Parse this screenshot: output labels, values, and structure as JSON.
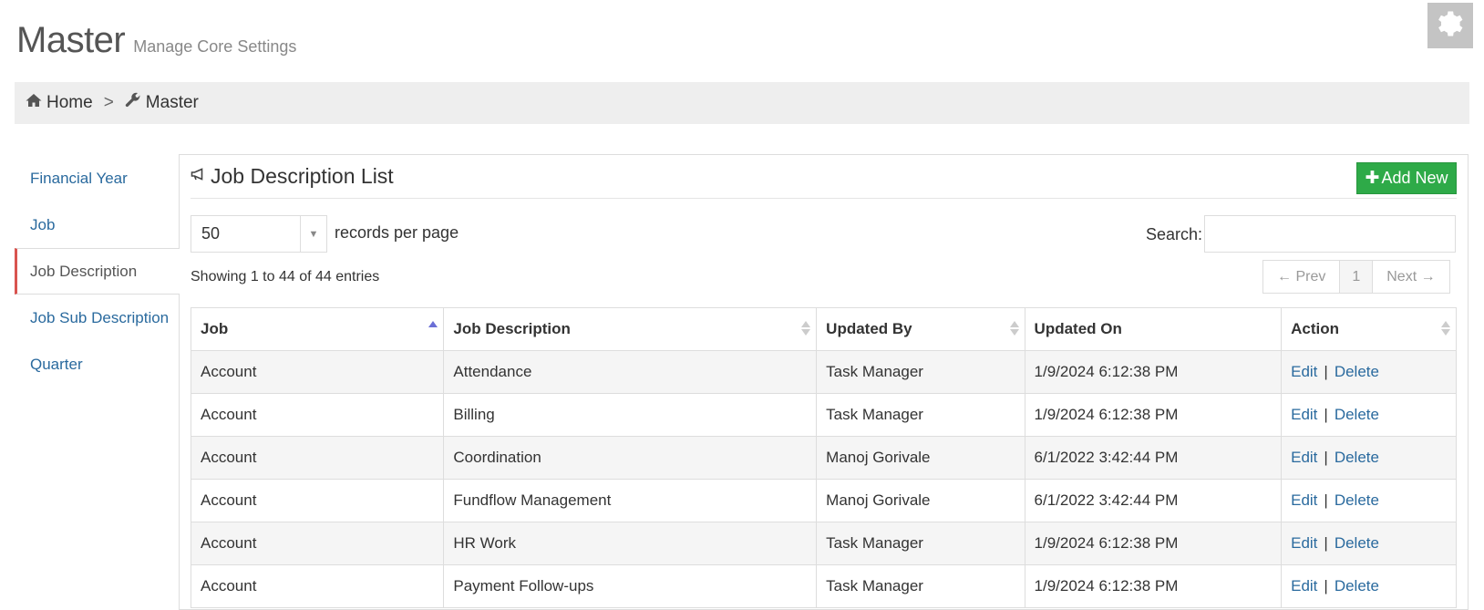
{
  "header": {
    "title": "Master",
    "subtitle": "Manage Core Settings"
  },
  "breadcrumb": {
    "home": "Home",
    "separator": ">",
    "current": "Master"
  },
  "sidebar": {
    "items": [
      {
        "label": "Financial Year"
      },
      {
        "label": "Job"
      },
      {
        "label": "Job Description",
        "active": true
      },
      {
        "label": "Job Sub Description"
      },
      {
        "label": "Quarter"
      }
    ]
  },
  "panel": {
    "title": "Job Description List",
    "add_label": "Add New",
    "add_color": "#2eaa48"
  },
  "controls": {
    "page_length": "50",
    "page_length_label": "records per page",
    "search_label": "Search:",
    "search_value": "",
    "info": "Showing 1 to 44 of 44 entries"
  },
  "pagination": {
    "prev": "← Prev",
    "page": "1",
    "next": "Next →"
  },
  "table": {
    "columns": [
      "Job",
      "Job Description",
      "Updated By",
      "Updated On",
      "Action"
    ],
    "sorted_column": "Job",
    "rows": [
      {
        "job": "Account",
        "description": "Attendance",
        "updated_by": "Task Manager",
        "updated_on": "1/9/2024 6:12:38 PM",
        "edit": "Edit",
        "sep": "|",
        "delete": "Delete"
      },
      {
        "job": "Account",
        "description": "Billing",
        "updated_by": "Task Manager",
        "updated_on": "1/9/2024 6:12:38 PM",
        "edit": "Edit",
        "sep": "|",
        "delete": "Delete"
      },
      {
        "job": "Account",
        "description": "Coordination",
        "updated_by": "Manoj Gorivale",
        "updated_on": "6/1/2022 3:42:44 PM",
        "edit": "Edit",
        "sep": "|",
        "delete": "Delete"
      },
      {
        "job": "Account",
        "description": "Fundflow Management",
        "updated_by": "Manoj Gorivale",
        "updated_on": "6/1/2022 3:42:44 PM",
        "edit": "Edit",
        "sep": "|",
        "delete": "Delete"
      },
      {
        "job": "Account",
        "description": "HR Work",
        "updated_by": "Task Manager",
        "updated_on": "1/9/2024 6:12:38 PM",
        "edit": "Edit",
        "sep": "|",
        "delete": "Delete"
      },
      {
        "job": "Account",
        "description": "Payment Follow-ups",
        "updated_by": "Task Manager",
        "updated_on": "1/9/2024 6:12:38 PM",
        "edit": "Edit",
        "sep": "|",
        "delete": "Delete"
      }
    ]
  },
  "icons": {
    "settings": "gear-icon",
    "home": "home-icon",
    "master": "wrench-icon",
    "list": "megaphone-icon",
    "add": "plus-icon"
  }
}
